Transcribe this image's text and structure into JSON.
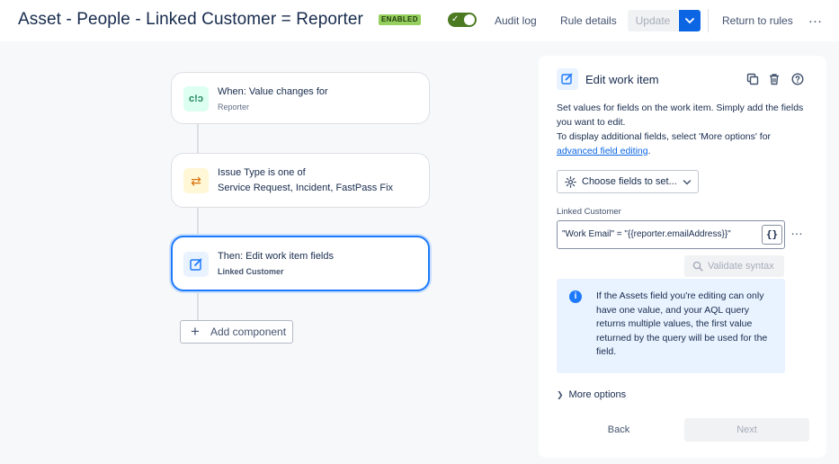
{
  "header": {
    "title": "Asset - People - Linked Customer = Reporter",
    "status_lozenge": "ENABLED",
    "toggle_state": "on",
    "audit_log_label": "Audit log",
    "rule_details_label": "Rule details",
    "update_label": "Update",
    "return_label": "Return to rules",
    "more_label": "…"
  },
  "flow": {
    "trigger": {
      "title": "When: Value changes for",
      "subtitle": "Reporter",
      "icon": "field-change-icon",
      "icon_glyph": "c!ɔ"
    },
    "condition": {
      "line1": "Issue Type is one of",
      "line2": "Service Request, Incident, FastPass Fix",
      "icon": "branch-arrows-icon",
      "icon_glyph": "⇄"
    },
    "action": {
      "title": "Then: Edit work item fields",
      "subtitle": "Linked Customer",
      "icon": "edit-icon"
    },
    "add_component_label": "Add component"
  },
  "panel": {
    "title": "Edit work item",
    "desc_line1": "Set values for fields on the work item. Simply add the fields you want to edit.",
    "desc_line2": "To display additional fields, select 'More options' for",
    "desc_link": "advanced field editing",
    "desc_end": ".",
    "choose_fields_label": "Choose fields to set...",
    "field_label": "Linked Customer",
    "field_value": "\"Work Email\" = \"{{reporter.emailAddress}}\"",
    "brace_label": "{}",
    "validate_label": "Validate syntax",
    "info_text": "If the Assets field you're editing can only have one value, and your AQL query returns multiple values, the first value returned by the query will be used for the field.",
    "more_options_label": "More options",
    "back_label": "Back",
    "next_label": "Next"
  },
  "colors": {
    "primary": "#0c66e4",
    "enabled_lozenge": "#95cf5e",
    "toggle_on": "#4c7a23",
    "selected_border": "#1d7afc",
    "info_bg": "#e9f2ff"
  }
}
